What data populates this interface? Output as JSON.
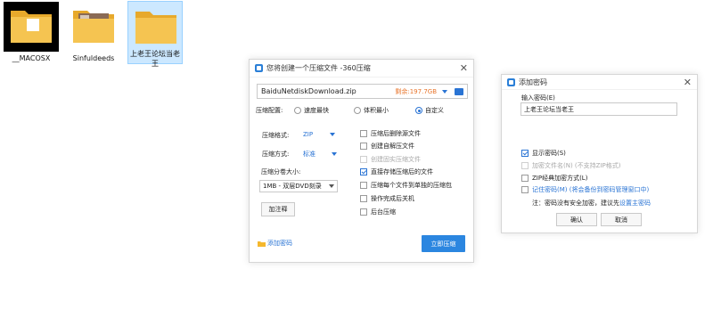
{
  "desktop": {
    "icons": [
      {
        "label": "__MACOSX"
      },
      {
        "label": "Sinfuldeeds"
      },
      {
        "label": "上老王论坛当老王"
      }
    ]
  },
  "compress_dialog": {
    "title": "您将创建一个压缩文件 -360压缩",
    "filename": "BaiduNetdiskDownload.zip",
    "free_space": "剩余:197.7GB",
    "config_label": "压缩配置:",
    "config_options": [
      "速度最快",
      "体积最小",
      "自定义"
    ],
    "config_selected": "自定义",
    "format_label": "压缩格式:",
    "format_value": "ZIP",
    "method_label": "压缩方式:",
    "method_value": "标准",
    "split_label": "压缩分卷大小:",
    "split_value": "1MB  - 双层DVD刻录",
    "comment_button": "加注释",
    "add_password_link": "添加密码",
    "compress_button": "立即压缩",
    "options": [
      {
        "label": "压缩后删除源文件",
        "checked": false,
        "disabled": false
      },
      {
        "label": "创建自解压文件",
        "checked": false,
        "disabled": false
      },
      {
        "label": "创建固实压缩文件",
        "checked": false,
        "disabled": true
      },
      {
        "label": "直接存储压缩后的文件",
        "checked": true,
        "disabled": false
      },
      {
        "label": "压缩每个文件到单独的压缩包",
        "checked": false,
        "disabled": false
      },
      {
        "label": "操作完成后关机",
        "checked": false,
        "disabled": false
      },
      {
        "label": "后台压缩",
        "checked": false,
        "disabled": false
      }
    ]
  },
  "password_dialog": {
    "title": "添加密码",
    "input_label": "输入密码(E)",
    "password_value": "上老王论坛当老王",
    "show_password": "显示密码(S)",
    "encrypt_names": "加密文件名(N) (不支持ZIP格式)",
    "zip_classic": "ZIP经典加密方式(L)",
    "remember": "记住密码(M) (将会备份到密码管理窗口中)",
    "note_prefix": "注：密码没有安全加密，建议先",
    "note_link": "设置主密码",
    "ok_button": "确认",
    "cancel_button": "取消"
  },
  "colors": {
    "accent": "#2b86e0",
    "free_space": "#e8762d",
    "folder": "#f5c451",
    "selection": "#cce8ff"
  }
}
